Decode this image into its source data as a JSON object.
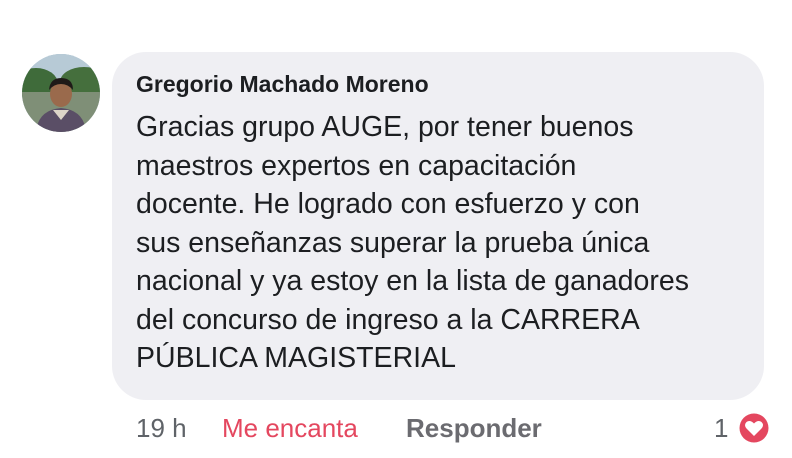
{
  "comment": {
    "author": "Gregorio Machado Moreno",
    "lines": [
      "Gracias grupo AUGE, por tener buenos",
      "maestros expertos en capacitación",
      "docente. He logrado con esfuerzo y con",
      "sus enseñanzas superar la prueba única",
      "nacional y ya estoy en la lista de ganadores",
      "del concurso de ingreso a la CARRERA",
      "PÚBLICA MAGISTERIAL"
    ]
  },
  "actions": {
    "timestamp": "19 h",
    "reaction_label": "Me encanta",
    "reply_label": "Responder",
    "reaction_count": "1"
  },
  "icons": {
    "avatar": "profile-photo",
    "reaction": "love-heart-icon"
  },
  "colors": {
    "bubble": "#efeff3",
    "love": "#e4475f",
    "text": "#1c1e21",
    "muted": "#5f6368"
  }
}
